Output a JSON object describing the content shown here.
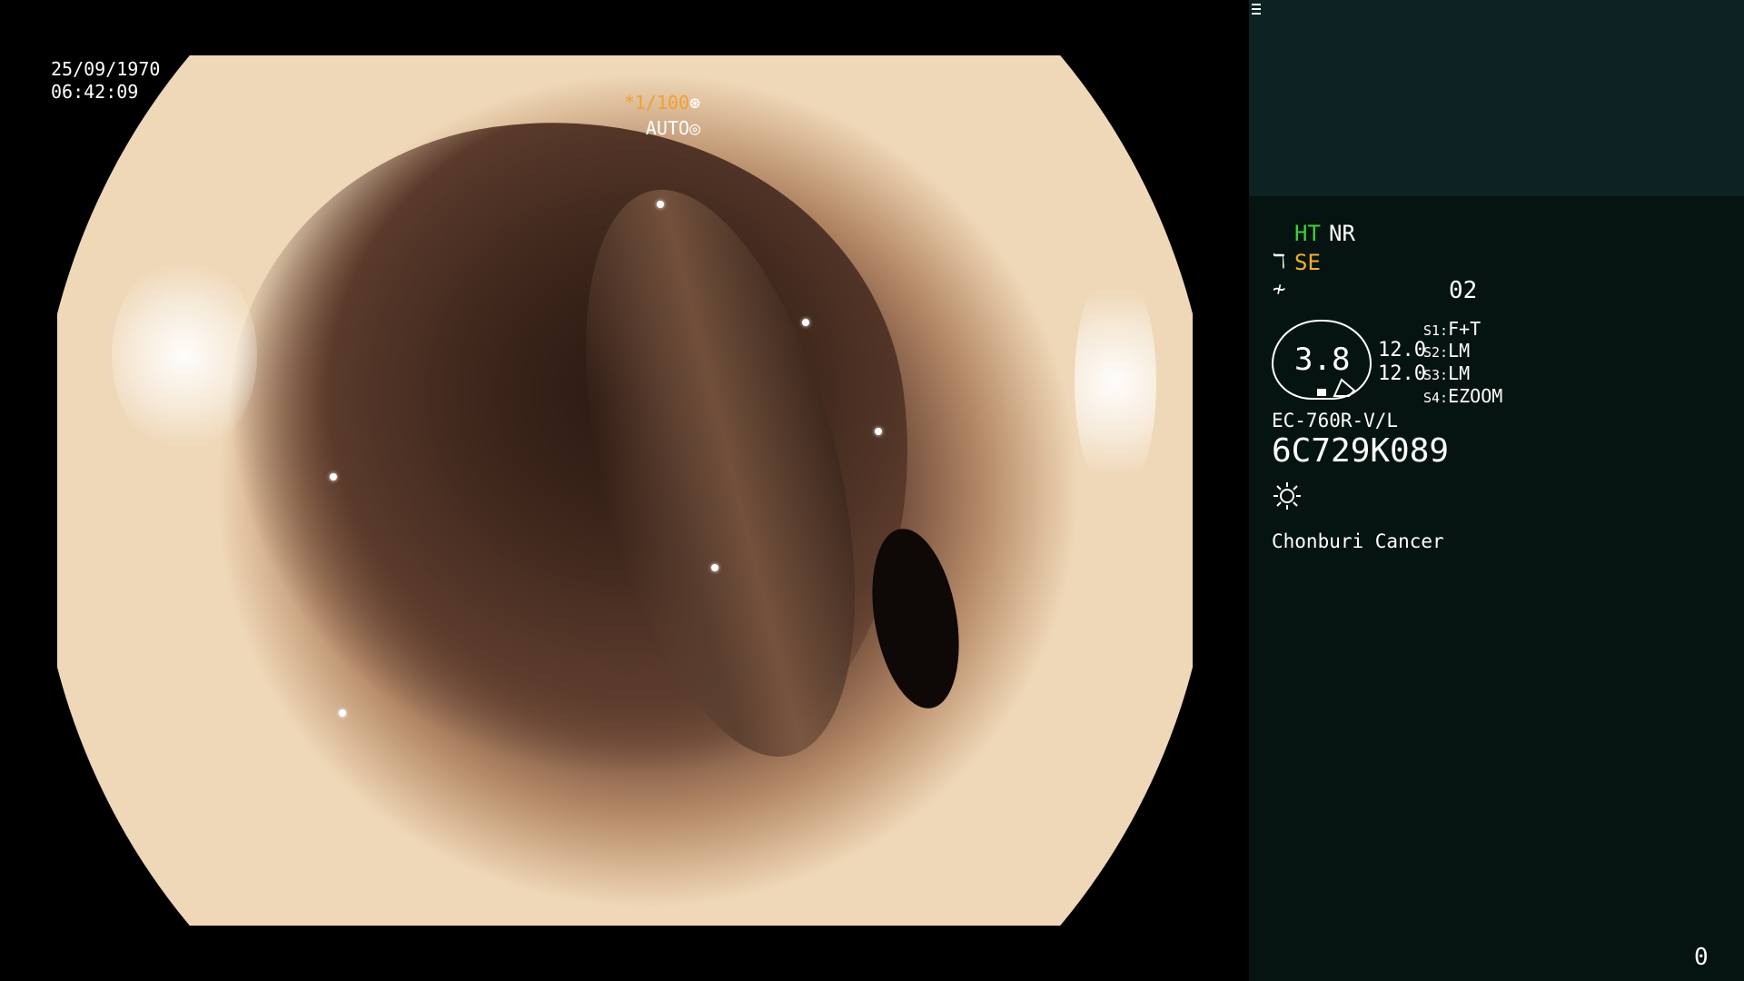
{
  "video": {
    "date": "25/09/1970",
    "time": "06:42:09",
    "shutter": "*1/100",
    "exposure_mode": "AUTO",
    "icons": [
      "aperture-icon",
      "auto-iris-icon"
    ]
  },
  "panel": {
    "ht": "HT",
    "nr": "NR",
    "se": "SE",
    "memory_slot": "02",
    "scale_value": "3.8",
    "value_1": "12.0",
    "value_2": "12.0",
    "switches": [
      {
        "key": "S1:",
        "value": "F+T"
      },
      {
        "key": "S2:",
        "value": "LM"
      },
      {
        "key": "S3:",
        "value": "LM"
      },
      {
        "key": "S4:",
        "value": "EZOOM"
      }
    ],
    "model": "EC-760R-V/L",
    "serial": "6C729K089",
    "hospital": "Chonburi Cancer",
    "counter": "0",
    "colors": {
      "green": "#3fd03f",
      "amber": "#f0b030",
      "panel_bg": "#061411",
      "panel_top": "#0d2323"
    }
  }
}
